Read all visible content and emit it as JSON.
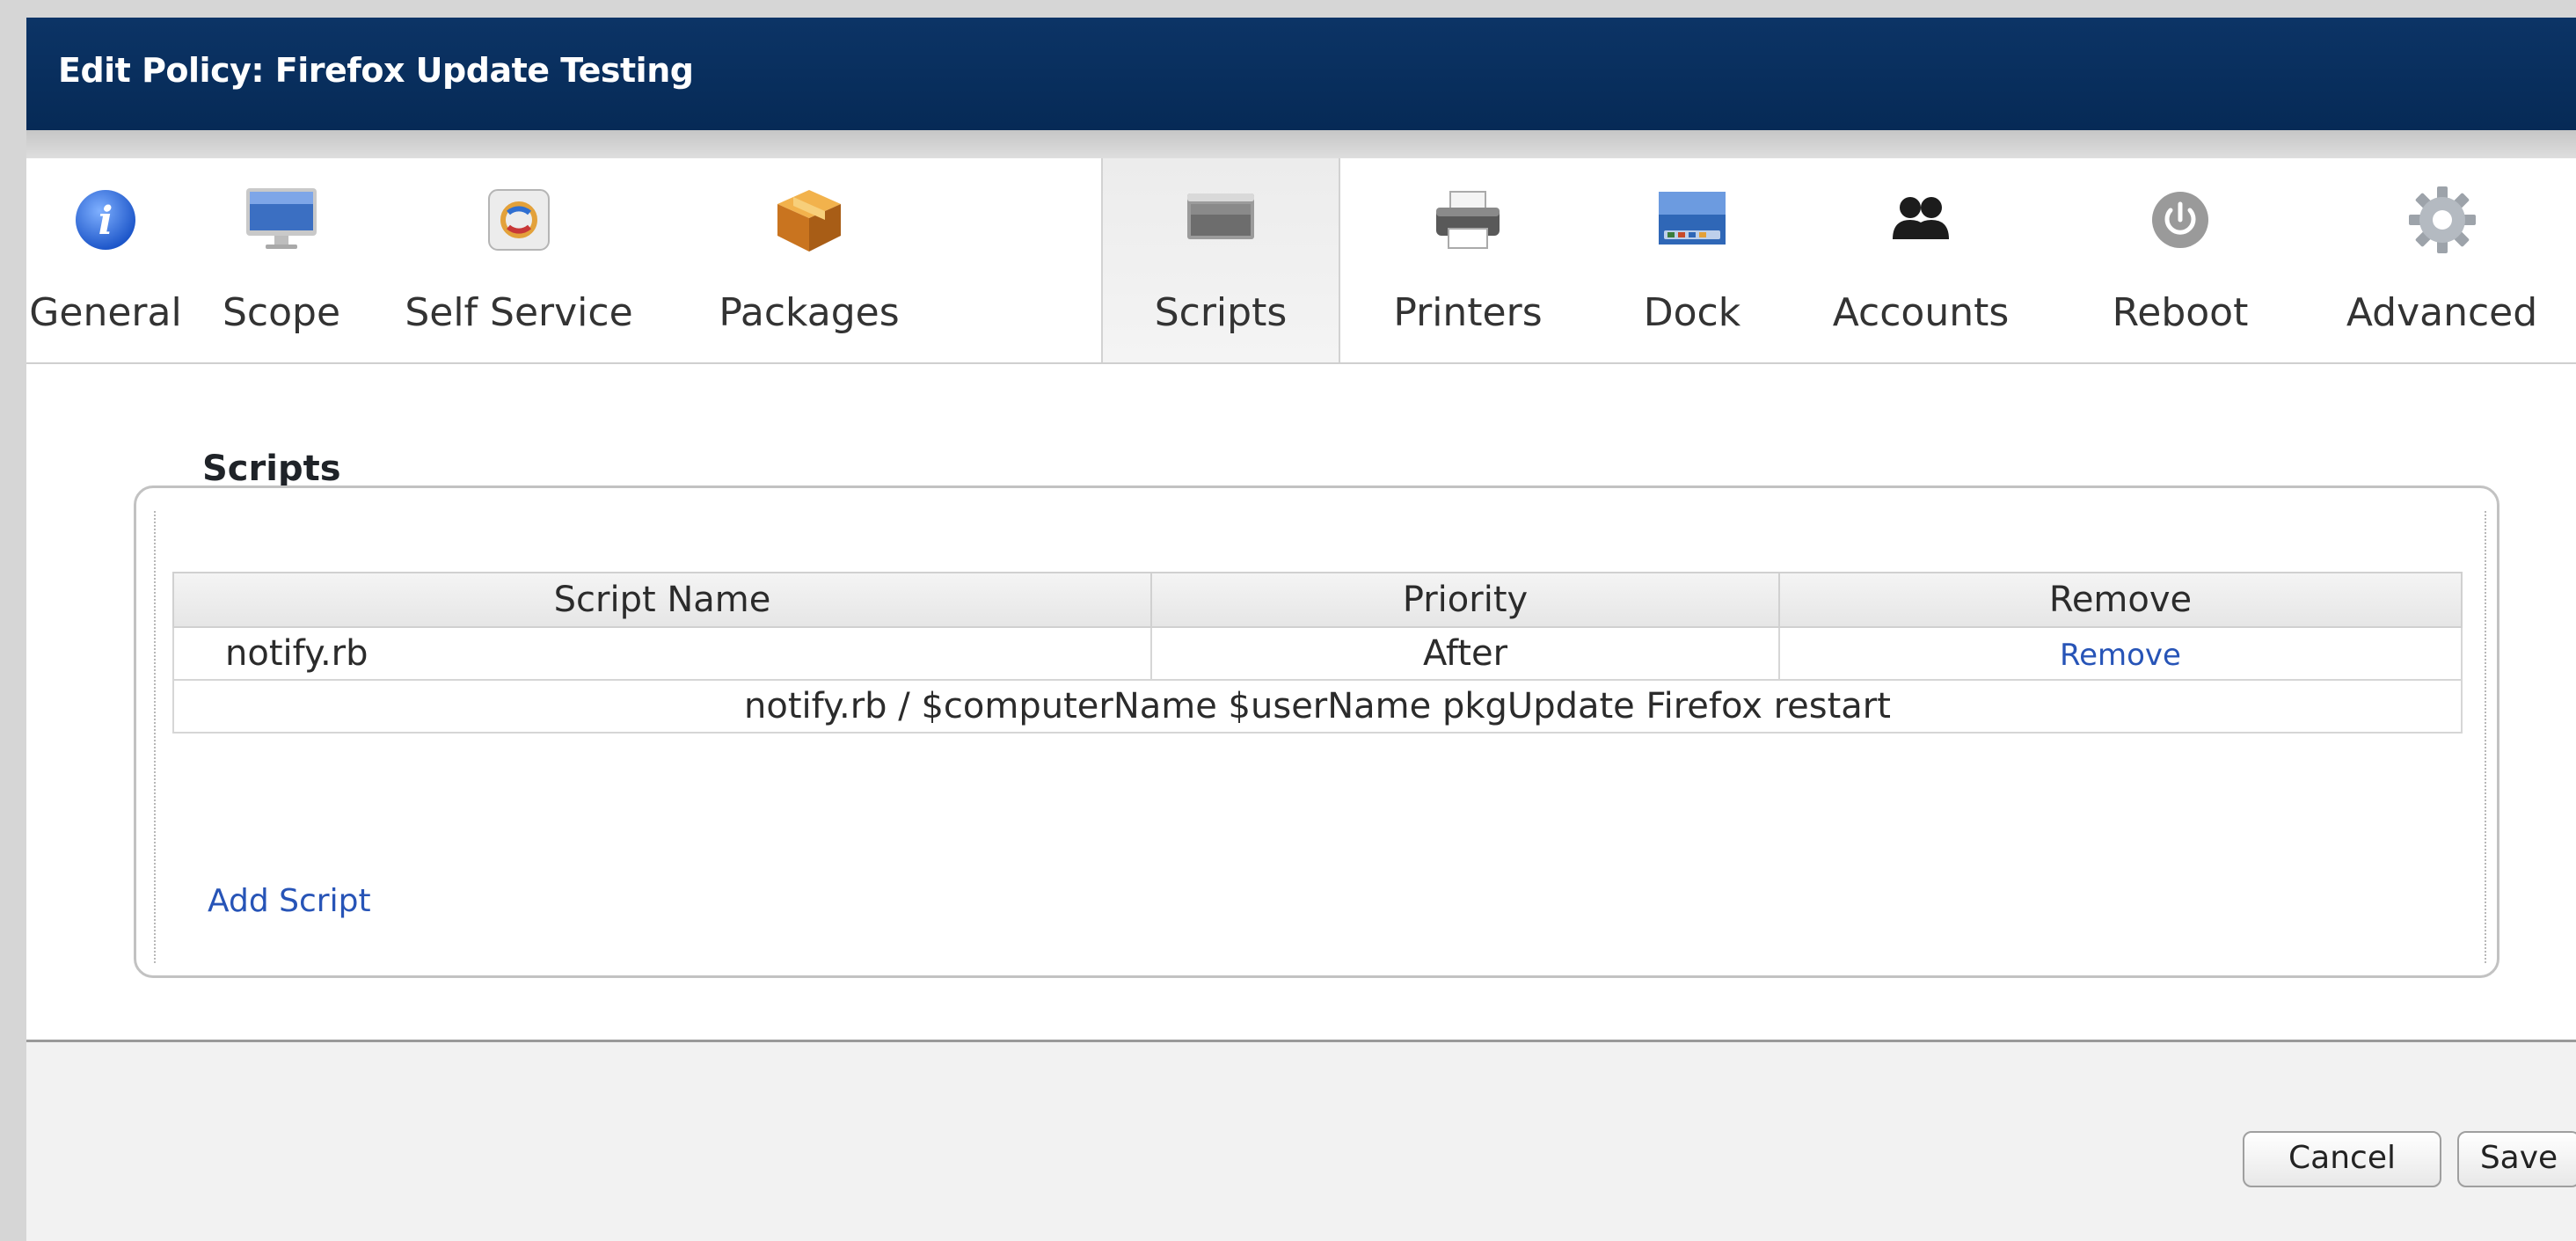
{
  "window": {
    "title": "Edit Policy: Firefox Update Testing"
  },
  "tabs": [
    {
      "label": "General",
      "icon": "info-icon"
    },
    {
      "label": "Scope",
      "icon": "imac-icon"
    },
    {
      "label": "Self Service",
      "icon": "self-service-icon"
    },
    {
      "label": "Packages",
      "icon": "package-icon"
    },
    {
      "label": "Scripts",
      "icon": "script-icon",
      "selected": true
    },
    {
      "label": "Printers",
      "icon": "printer-icon"
    },
    {
      "label": "Dock",
      "icon": "dock-icon"
    },
    {
      "label": "Accounts",
      "icon": "accounts-icon"
    },
    {
      "label": "Reboot",
      "icon": "power-icon"
    },
    {
      "label": "Advanced",
      "icon": "gear-icon"
    }
  ],
  "scripts_section": {
    "title": "Scripts",
    "columns": [
      "Script Name",
      "Priority",
      "Remove"
    ],
    "rows": [
      {
        "name": "notify.rb",
        "priority": "After",
        "remove_label": "Remove",
        "detail": "notify.rb / $computerName $userName pkgUpdate Firefox restart"
      }
    ],
    "add_label": "Add Script"
  },
  "footer": {
    "cancel_label": "Cancel",
    "save_label": "Save"
  },
  "colors": {
    "titlebar": "#062a56",
    "link": "#2754b7",
    "active_tab": "#ececec"
  }
}
